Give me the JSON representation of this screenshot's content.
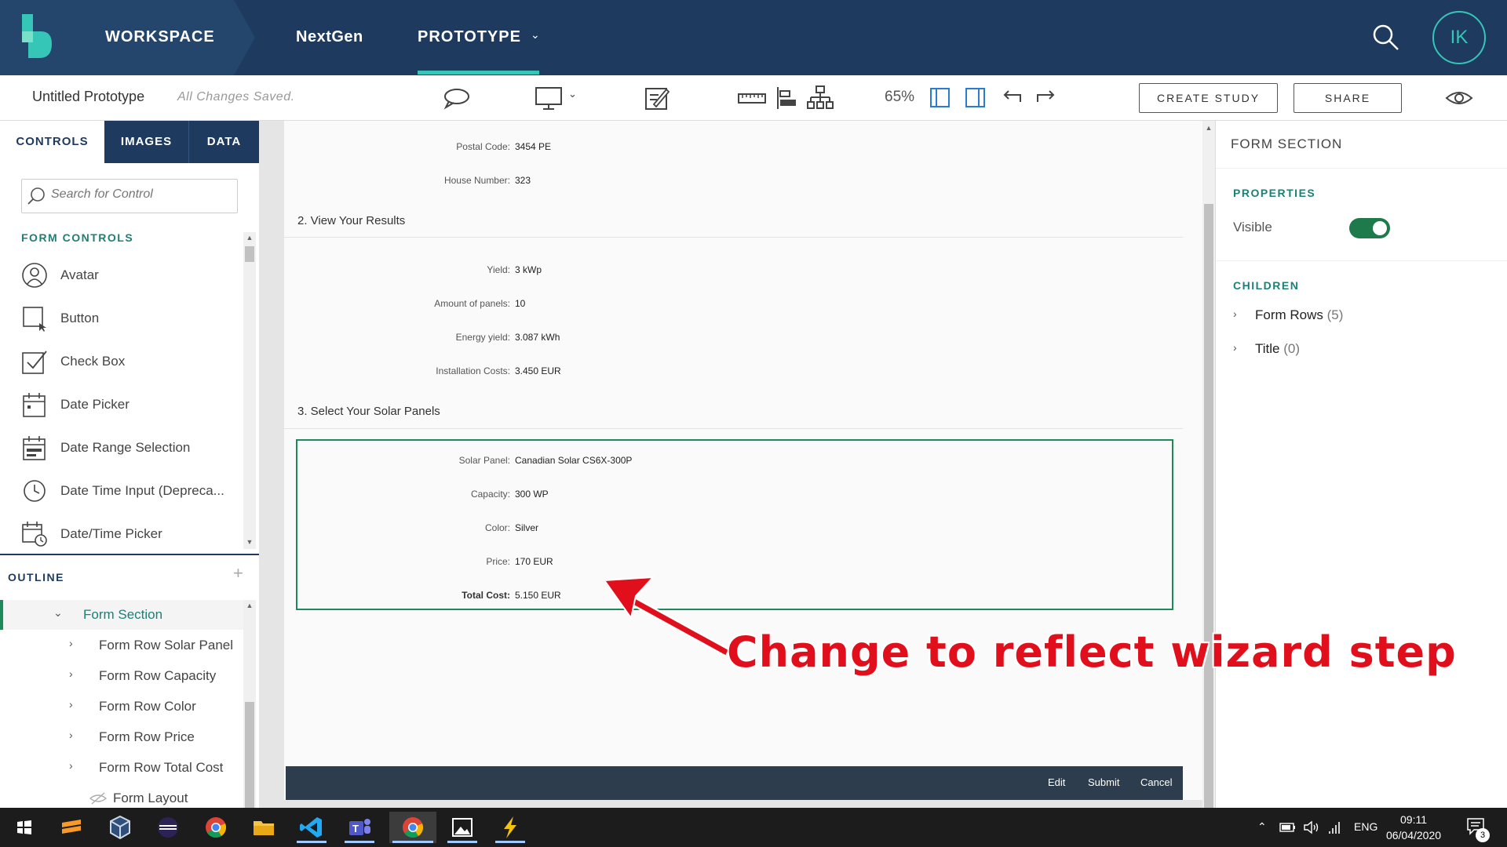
{
  "header": {
    "workspace": "WORKSPACE",
    "project": "NextGen",
    "mode": "PROTOTYPE",
    "user_initials": "IK",
    "accent_color": "#36c6b7",
    "brand_color": "#1e3a5f"
  },
  "toolbar": {
    "title": "Untitled Prototype",
    "status": "All Changes Saved.",
    "zoom": "65%",
    "create_study": "CREATE STUDY",
    "share": "SHARE",
    "icons": [
      "comment-icon",
      "device-monitor-icon",
      "chevron-down-icon",
      "notes-icon",
      "ruler-icon",
      "align-icon",
      "hierarchy-icon",
      "layout-left-icon",
      "layout-right-icon",
      "undo-icon",
      "redo-icon",
      "preview-eye-icon"
    ]
  },
  "left_panel": {
    "tabs": [
      "CONTROLS",
      "IMAGES",
      "DATA"
    ],
    "active_tab": "CONTROLS",
    "search_placeholder": "Search for Control",
    "section": "FORM CONTROLS",
    "controls": [
      {
        "label": "Avatar",
        "icon": "avatar-icon"
      },
      {
        "label": "Button",
        "icon": "button-icon"
      },
      {
        "label": "Check Box",
        "icon": "checkbox-icon"
      },
      {
        "label": "Date Picker",
        "icon": "calendar-icon"
      },
      {
        "label": "Date Range Selection",
        "icon": "date-range-icon"
      },
      {
        "label": "Date Time Input (Depreca...",
        "icon": "clock-icon"
      },
      {
        "label": "Date/Time Picker",
        "icon": "datetime-icon"
      }
    ],
    "outline_title": "OUTLINE",
    "outline": [
      {
        "label": "Form Section",
        "selected": true
      },
      {
        "label": "Form Row Solar Panel"
      },
      {
        "label": "Form Row Capacity"
      },
      {
        "label": "Form Row Color"
      },
      {
        "label": "Form Row Price"
      },
      {
        "label": "Form Row Total Cost"
      },
      {
        "label": "Form Layout"
      }
    ]
  },
  "canvas": {
    "rows_top": [
      {
        "key": "Postal Code:",
        "value": "3454 PE"
      },
      {
        "key": "House Number:",
        "value": "323"
      }
    ],
    "section2": "2. View Your Results",
    "rows_results": [
      {
        "key": "Yield:",
        "value": "3 kWp"
      },
      {
        "key": "Amount of panels:",
        "value": "10"
      },
      {
        "key": "Energy yield:",
        "value": "3.087 kWh"
      },
      {
        "key": "Installation Costs:",
        "value": "3.450 EUR"
      }
    ],
    "section3": "3. Select Your Solar Panels",
    "rows_panels": [
      {
        "key": "Solar Panel:",
        "value": "Canadian Solar CS6X-300P"
      },
      {
        "key": "Capacity:",
        "value": "300 WP"
      },
      {
        "key": "Color:",
        "value": "Silver"
      },
      {
        "key": "Price:",
        "value": "170 EUR"
      },
      {
        "key": "Total Cost:",
        "value": "5.150 EUR"
      }
    ],
    "footer": {
      "edit": "Edit",
      "submit": "Submit",
      "cancel": "Cancel"
    }
  },
  "right_panel": {
    "title": "FORM SECTION",
    "properties": "PROPERTIES",
    "visible_label": "Visible",
    "visible": true,
    "children_head": "CHILDREN",
    "children": [
      {
        "name": "Form Rows",
        "count": "(5)"
      },
      {
        "name": "Title",
        "count": "(0)"
      }
    ]
  },
  "annotation": {
    "text": "Change to reflect wizard step",
    "color": "#e00f1b"
  },
  "taskbar": {
    "apps": [
      "start-icon",
      "sublime-icon",
      "virtualbox-icon",
      "eclipse-icon",
      "chrome-icon",
      "file-explorer-icon",
      "vscode-icon",
      "teams-icon",
      "chrome-active-icon",
      "photos-icon",
      "bolt-app-icon"
    ],
    "language": "ENG",
    "time": "09:11",
    "date": "06/04/2020",
    "notifications": "3"
  }
}
